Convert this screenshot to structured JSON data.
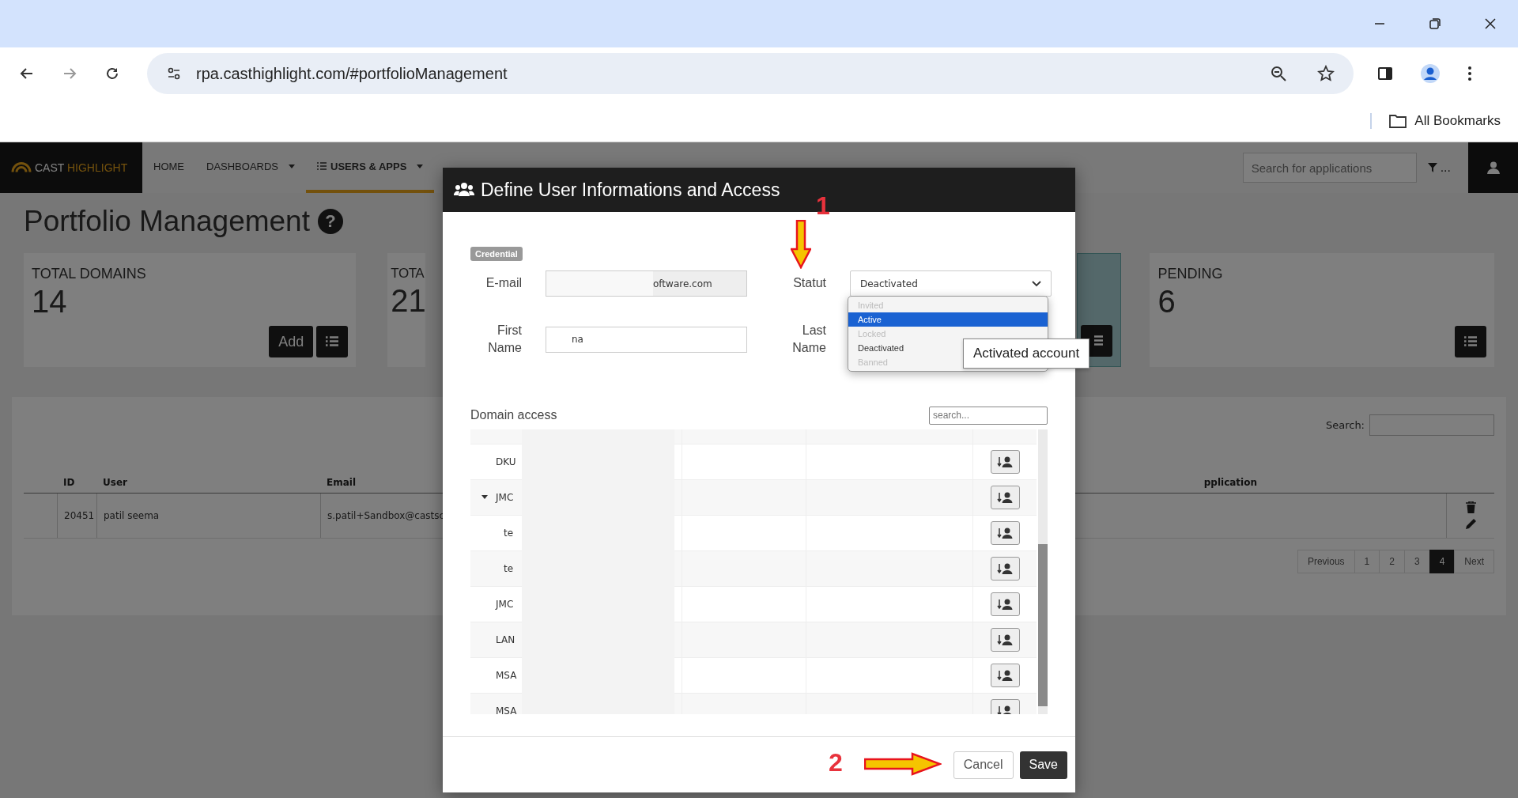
{
  "browser": {
    "url": "rpa.casthighlight.com/#portfolioManagement",
    "bookmarks": "All Bookmarks"
  },
  "nav": {
    "logo_a": "CAST",
    "logo_b": "HIGHLIGHT",
    "items": [
      {
        "label": "HOME",
        "selected": false,
        "dropdown": false
      },
      {
        "label": "DASHBOARDS",
        "selected": false,
        "dropdown": true
      },
      {
        "label": "USERS & APPS",
        "selected": true,
        "dropdown": true
      }
    ],
    "search_placeholder": "Search for applications",
    "filter_label": "..."
  },
  "page": {
    "title": "Portfolio Management",
    "help": "?"
  },
  "cards": [
    {
      "label": "TOTAL DOMAINS",
      "value": "14",
      "add": "Add",
      "selected": false
    },
    {
      "label": "TOTA",
      "value": "21",
      "selected": false
    },
    {
      "selected": true
    },
    {
      "label": "PENDING",
      "value": "6",
      "selected": false
    }
  ],
  "table": {
    "search_label": "Search:",
    "columns": [
      "ID",
      "User",
      "Email",
      "pplication"
    ],
    "rows": [
      {
        "id": "20451",
        "user": "patil seema",
        "email": "s.patil+Sandbox@castsc"
      }
    ],
    "pages": [
      {
        "label": "Previous",
        "selected": false
      },
      {
        "label": "1",
        "selected": false
      },
      {
        "label": "2",
        "selected": false
      },
      {
        "label": "3",
        "selected": false
      },
      {
        "label": "4",
        "selected": true
      },
      {
        "label": "Next",
        "selected": false
      }
    ]
  },
  "modal": {
    "title": "Define User Informations and Access",
    "badge": "Credential",
    "email_label": "E-mail",
    "email_value": "oftware.com",
    "statut_label": "Statut",
    "statut_value": "Deactivated",
    "options": [
      {
        "label": "Invited",
        "selected": false,
        "disabled": true
      },
      {
        "label": "Active",
        "selected": true,
        "disabled": false
      },
      {
        "label": "Locked",
        "selected": false,
        "disabled": true
      },
      {
        "label": "Deactivated",
        "selected": false,
        "disabled": false
      },
      {
        "label": "Banned",
        "selected": false,
        "disabled": true
      }
    ],
    "tooltip": "Activated account",
    "first_name_label": "First Name",
    "first_name_value": "na",
    "last_name_label": "Last Name",
    "domain_label": "Domain access",
    "domain_search_placeholder": "search...",
    "domains": [
      {
        "name": "DKU"
      },
      {
        "name": "JMC",
        "expanded": true,
        "children": [
          {
            "name": "te"
          },
          {
            "name": "te"
          }
        ]
      },
      {
        "name": "JMC"
      },
      {
        "name": "LAN"
      },
      {
        "name": "MSA"
      },
      {
        "name": "MSA"
      }
    ],
    "cancel": "Cancel",
    "save": "Save"
  },
  "annotations": [
    {
      "label": "1",
      "kind": "down"
    },
    {
      "label": "2",
      "kind": "right"
    }
  ]
}
